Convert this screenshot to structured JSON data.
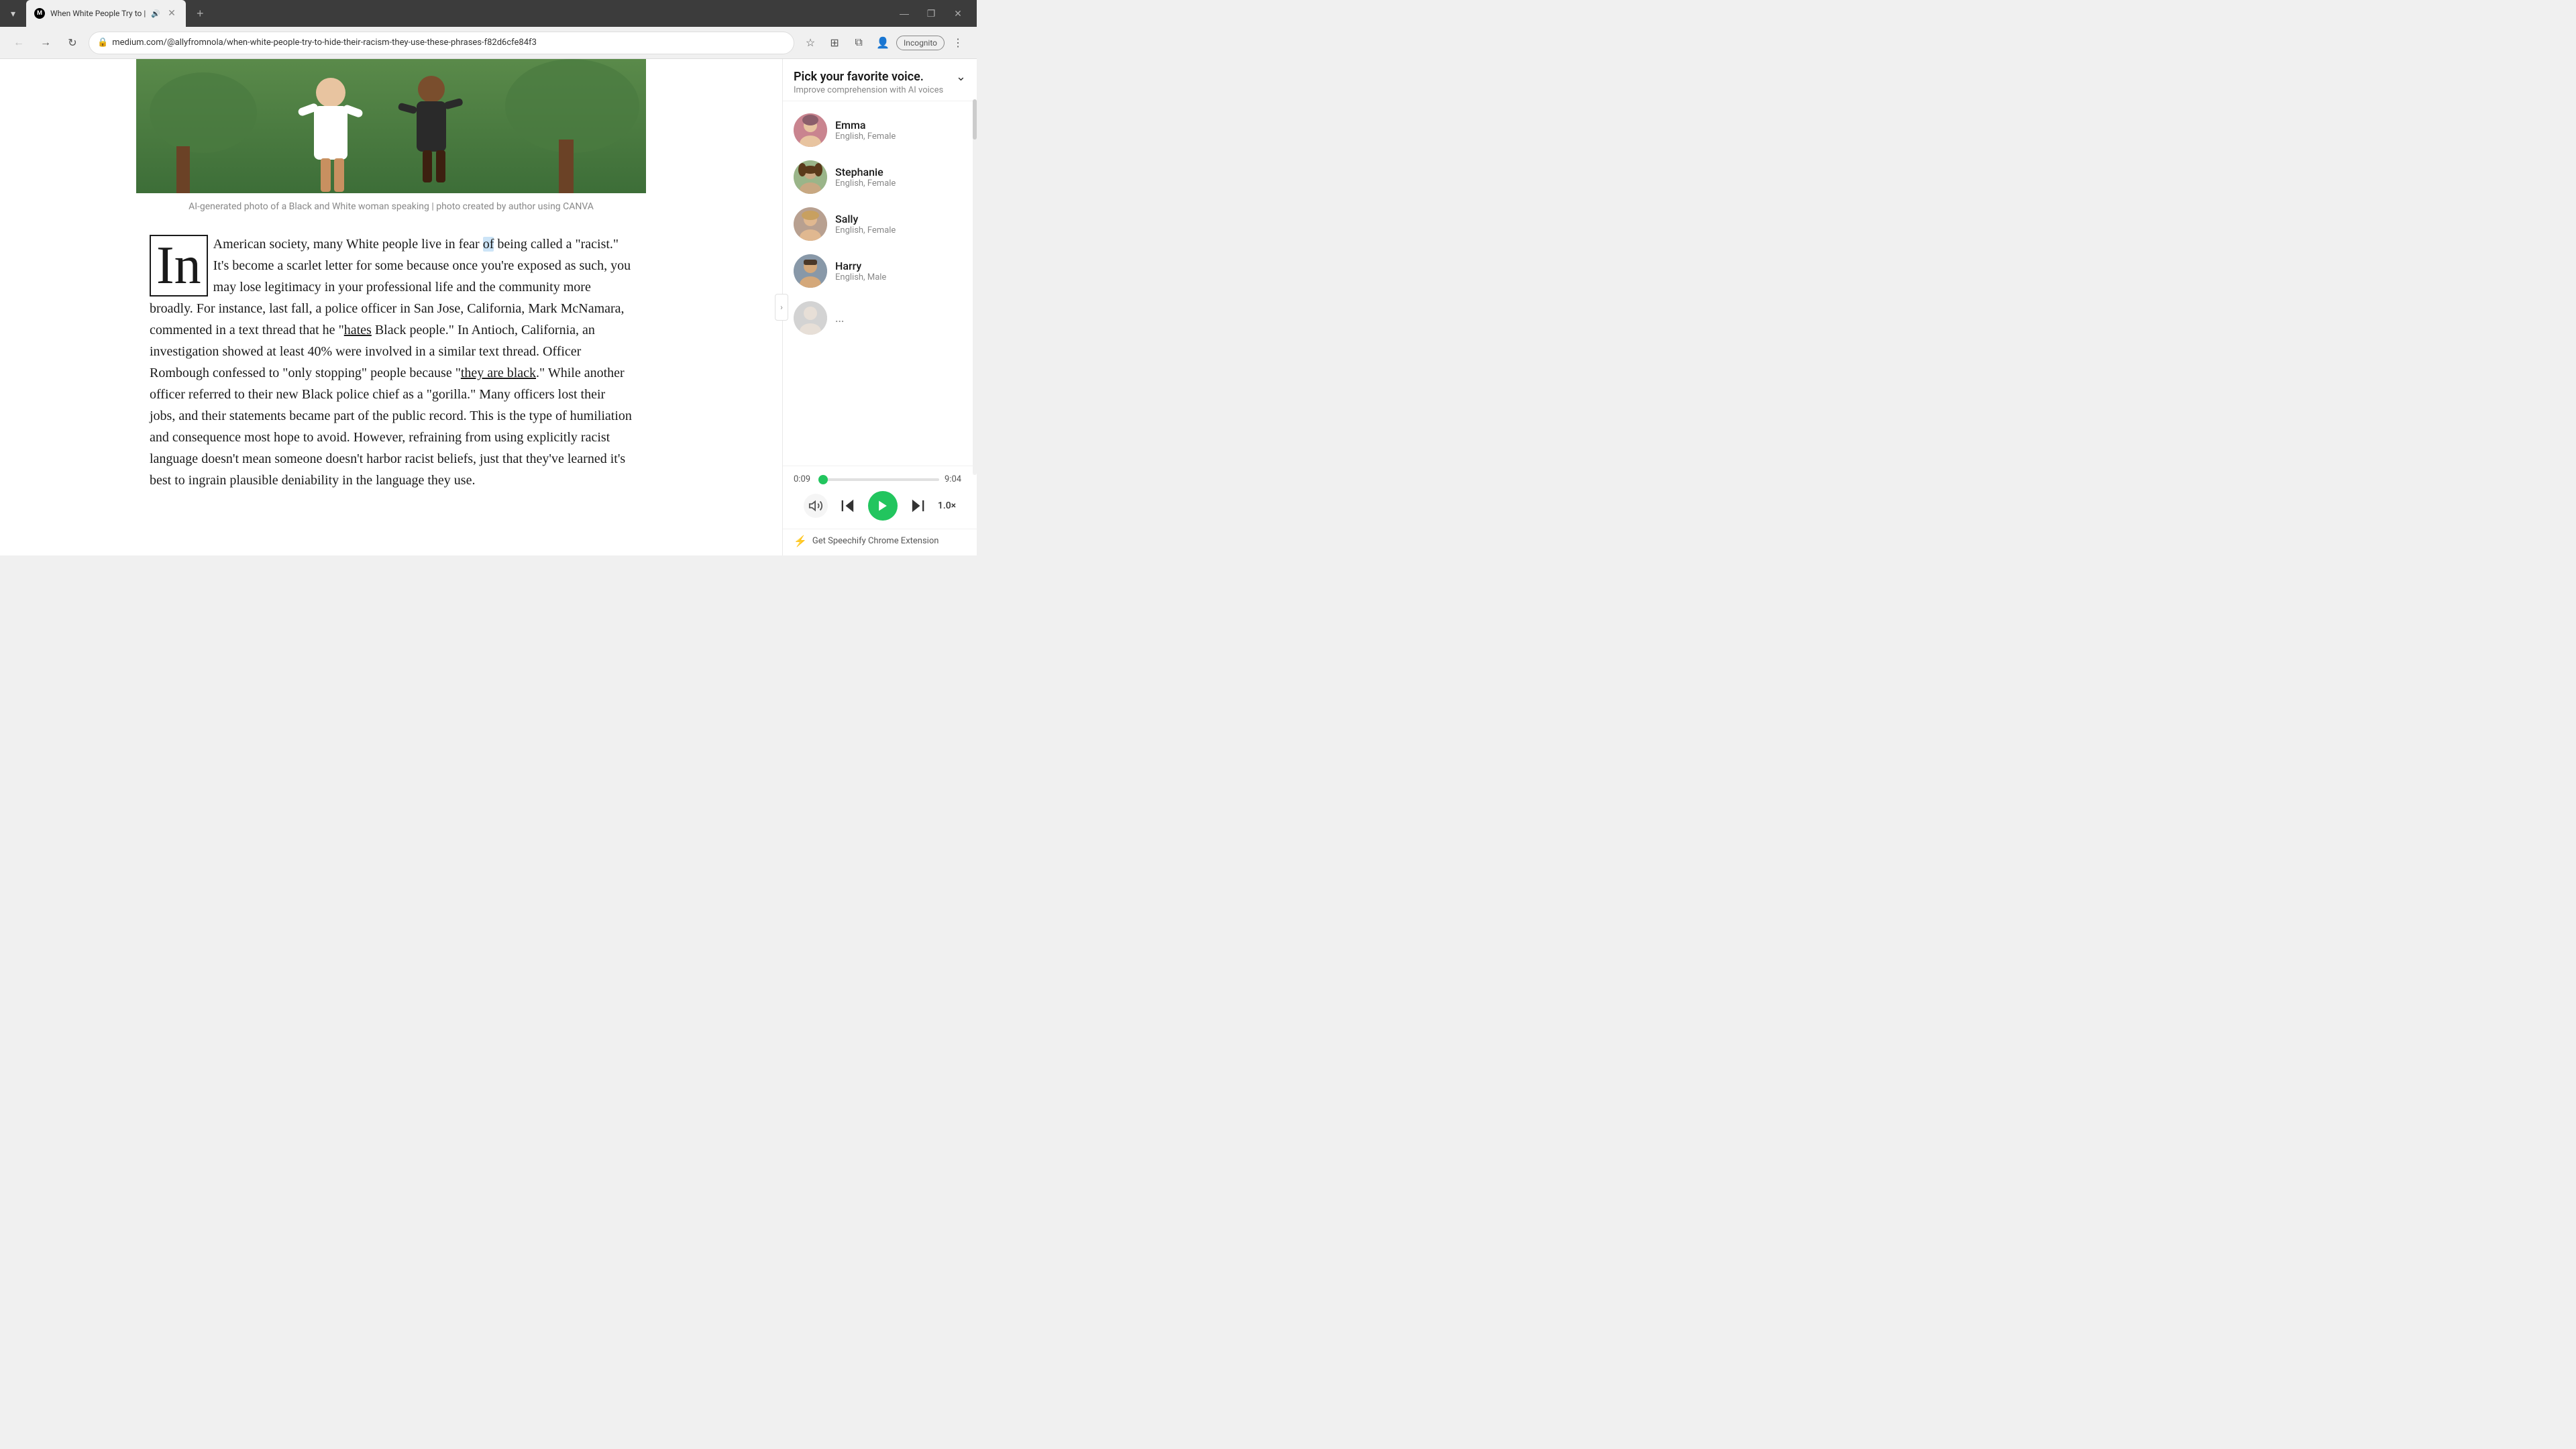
{
  "browser": {
    "tab_title": "When White People Try to |",
    "tab_audio_symbol": "🔊",
    "url": "medium.com/@allyfromnola/when-white-people-try-to-hide-their-racism-they-use-these-phrases-f82d6cfe84f3",
    "incognito_label": "Incognito",
    "window_minimize": "—",
    "window_restore": "❐",
    "window_close": "✕",
    "new_tab": "+"
  },
  "article": {
    "image_caption": "AI-generated photo of a Black and White woman speaking | photo created by author using CANVA",
    "drop_cap": "In",
    "body_text": "American society, many White people live in fear of being called a \"racist.\" It's become a scarlet letter for some because once you're exposed as such, you may lose legitimacy in your professional life and the community more broadly. For instance, last fall, a police officer in San Jose, California, Mark McNamara, commented in a text thread that he \"hates Black people.\" In Antioch, California, an investigation showed at least 40% were involved in a similar text thread. Officer Rombough confessed to \"only stopping\" people because \"they are black.\" While another officer referred to their new Black police chief as a \"gorilla.\" Many officers lost their jobs, and their statements became part of the public record. This is the type of humiliation and consequence most hope to avoid. However, refraining from using explicitly racist language doesn't mean someone doesn't harbor racist beliefs, just that they've learned it's best to ingrain plausible deniability in the language they use.",
    "highlighted_word": "of",
    "link_text_1": "hates",
    "link_text_2": "they are black"
  },
  "speechify": {
    "panel_title": "Pick your favorite voice.",
    "panel_subtitle": "Improve comprehension with AI voices",
    "voices": [
      {
        "id": "emma",
        "name": "Emma",
        "lang": "English, Female",
        "emoji": "👩"
      },
      {
        "id": "stephanie",
        "name": "Stephanie",
        "lang": "English, Female",
        "emoji": "👩"
      },
      {
        "id": "sally",
        "name": "Sally",
        "lang": "English, Female",
        "emoji": "👩"
      },
      {
        "id": "harry",
        "name": "Harry",
        "lang": "English, Male",
        "emoji": "👨"
      },
      {
        "id": "unknown",
        "name": "...",
        "lang": "",
        "emoji": "👤"
      }
    ],
    "player": {
      "current_time": "0:09",
      "total_time": "9:04",
      "speed": "1.0×",
      "extension_text": "Get Speechify Chrome Extension"
    }
  }
}
